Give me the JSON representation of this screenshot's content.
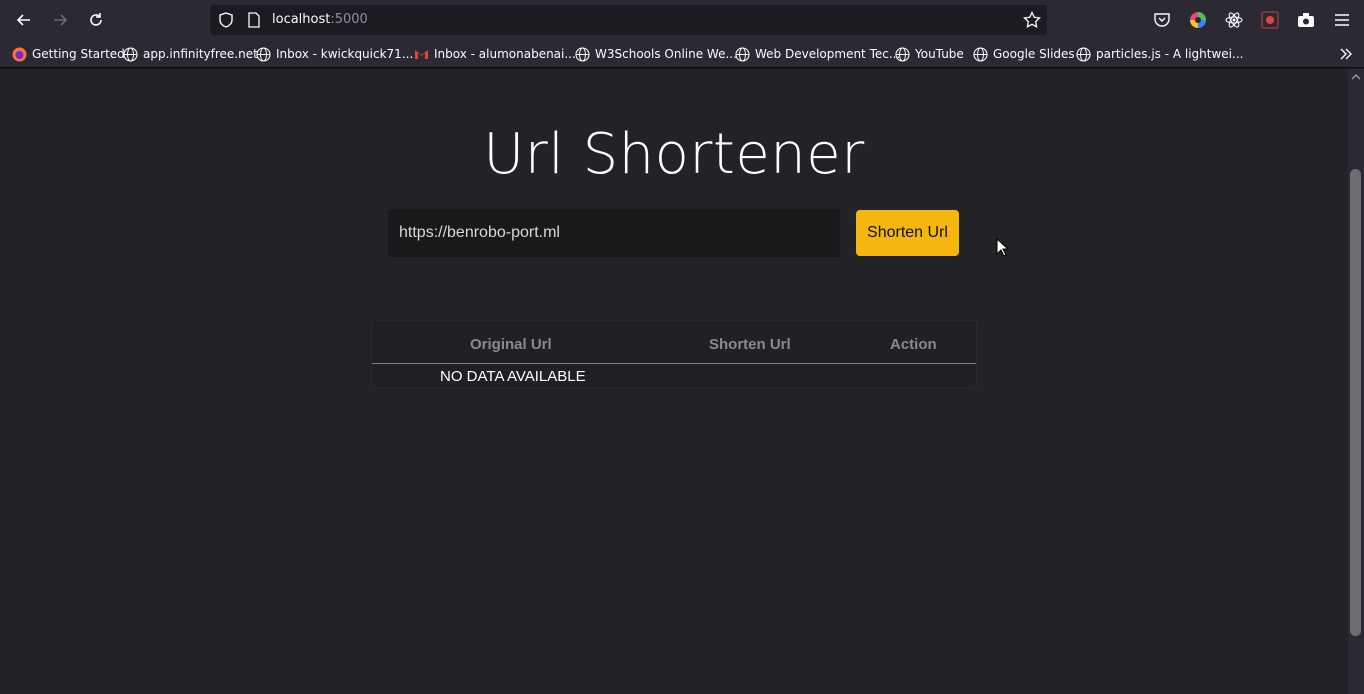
{
  "browser": {
    "url_host": "localhost",
    "url_port": ":5000",
    "bookmarks": [
      {
        "label": "Getting Started",
        "icon": "firefox-icon"
      },
      {
        "label": "app.infinityfree.net",
        "icon": "globe-icon"
      },
      {
        "label": "Inbox - kwickquick71...",
        "icon": "globe-icon"
      },
      {
        "label": "Inbox - alumonabenai...",
        "icon": "gmail-icon"
      },
      {
        "label": "W3Schools Online We...",
        "icon": "globe-icon"
      },
      {
        "label": "Web Development Tec...",
        "icon": "globe-icon"
      },
      {
        "label": "YouTube",
        "icon": "globe-icon"
      },
      {
        "label": "Google Slides",
        "icon": "globe-icon"
      },
      {
        "label": "particles.js - A lightwei...",
        "icon": "globe-icon"
      }
    ]
  },
  "app": {
    "title": "Url Shortener",
    "input_value": "https://benrobo-port.ml",
    "button_label": "Shorten Url",
    "accent_color": "#f5b60f"
  },
  "table": {
    "headers": [
      "Original Url",
      "Shorten Url",
      "Action"
    ],
    "empty_text": "NO DATA AVAILABLE"
  }
}
